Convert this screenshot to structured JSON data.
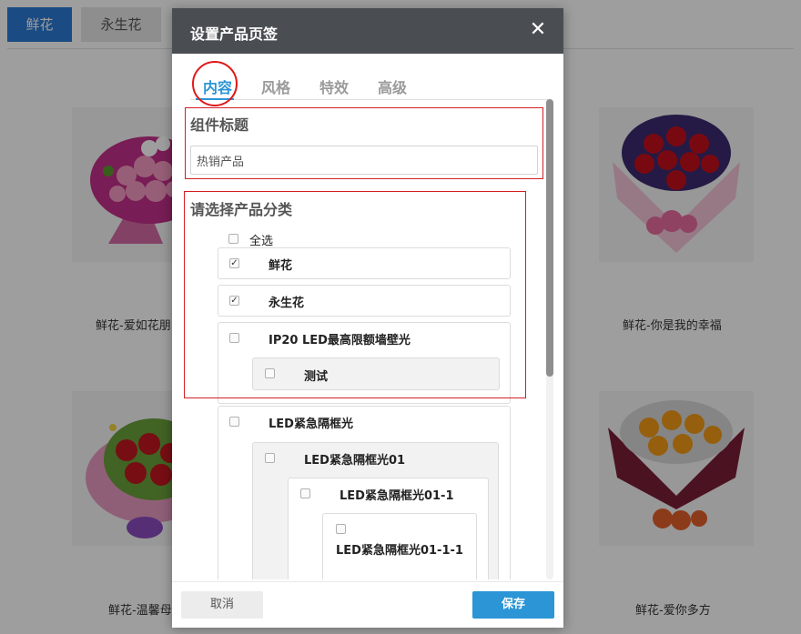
{
  "background": {
    "tabs": [
      {
        "label": "鲜花"
      },
      {
        "label": "永生花"
      }
    ],
    "products": [
      {
        "caption": "鲜花-爱如花朋"
      },
      {
        "caption": "鲜花-你是我的幸福"
      },
      {
        "caption": "鲜花-温馨母"
      },
      {
        "caption": "鲜花-爱你多方"
      }
    ]
  },
  "modal": {
    "title": "设置产品页签",
    "close_icon": "close-icon",
    "tabs": [
      {
        "label": "内容",
        "active": true
      },
      {
        "label": "风格",
        "active": false
      },
      {
        "label": "特效",
        "active": false
      },
      {
        "label": "高级",
        "active": false
      }
    ],
    "component_title": {
      "heading": "组件标题",
      "value": "热销产品"
    },
    "category": {
      "heading": "请选择产品分类",
      "select_all": {
        "label": "全选",
        "checked": false
      },
      "items": [
        {
          "label": "鲜花",
          "checked": true
        },
        {
          "label": "永生花",
          "checked": true
        },
        {
          "label": "IP20 LED最高限额墙壁光",
          "checked": false
        },
        {
          "label": "测试",
          "checked": false
        },
        {
          "label": "LED紧急隔框光",
          "checked": false
        },
        {
          "label": "LED紧急隔框光01",
          "checked": false
        },
        {
          "label": "LED紧急隔框光01-1",
          "checked": false
        },
        {
          "label": "LED紧急隔框光01-1-1",
          "checked": false
        }
      ]
    },
    "footer": {
      "cancel_label": "取消",
      "save_label": "保存"
    },
    "colors": {
      "header_bg": "#4a4e52",
      "accent": "#2b95d6",
      "annotation_red": "#d21f24"
    }
  }
}
